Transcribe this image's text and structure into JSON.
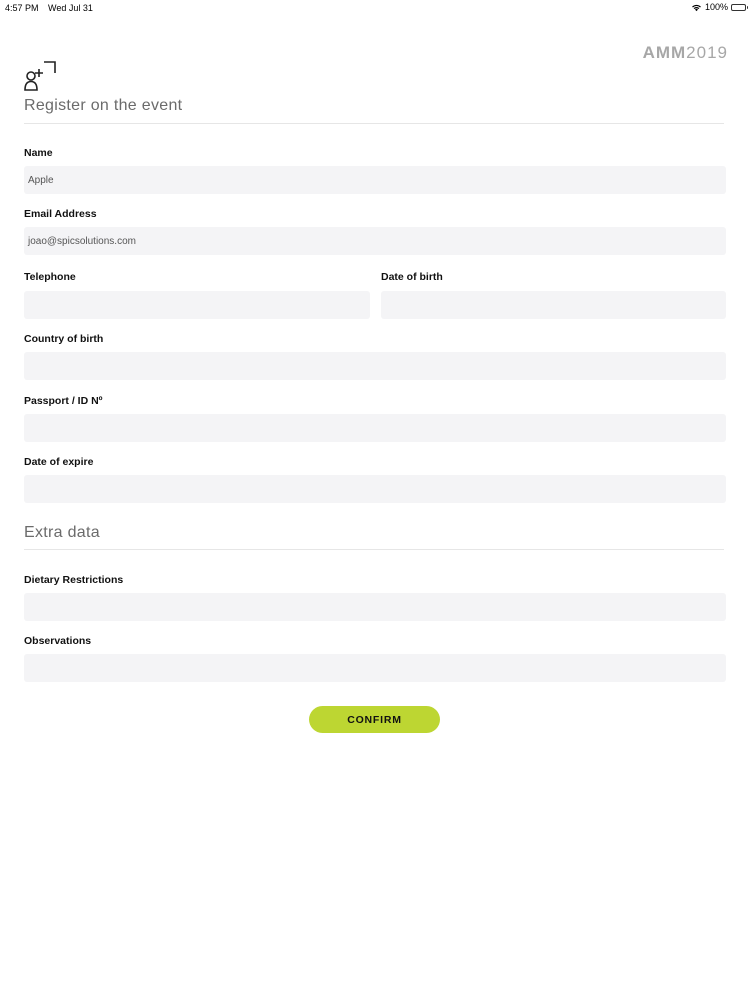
{
  "status_bar": {
    "time": "4:57 PM",
    "date": "Wed Jul 31",
    "battery": "100%"
  },
  "brand": {
    "name": "AMM",
    "year": "2019",
    "color": "#a7a7a7"
  },
  "header": {
    "icon": "add-user-icon",
    "title": "Register on the event"
  },
  "form": {
    "name": {
      "label": "Name",
      "value": "Apple"
    },
    "email": {
      "label": "Email Address",
      "value": "joao@spicsolutions.com"
    },
    "telephone": {
      "label": "Telephone",
      "value": ""
    },
    "date_of_birth": {
      "label": "Date of birth",
      "value": ""
    },
    "country_of_birth": {
      "label": "Country of birth",
      "value": ""
    },
    "passport": {
      "label": "Passport / ID Nº",
      "value": ""
    },
    "date_of_expire": {
      "label": "Date of expire",
      "value": ""
    }
  },
  "extra": {
    "title": "Extra data",
    "dietary": {
      "label": "Dietary Restrictions",
      "value": ""
    },
    "observations": {
      "label": "Observations",
      "value": ""
    }
  },
  "confirm": {
    "label": "CONFIRM",
    "color": "#bdd632"
  },
  "colors": {
    "input_background": "#f4f4f6",
    "title_text": "#6b6b6b"
  }
}
